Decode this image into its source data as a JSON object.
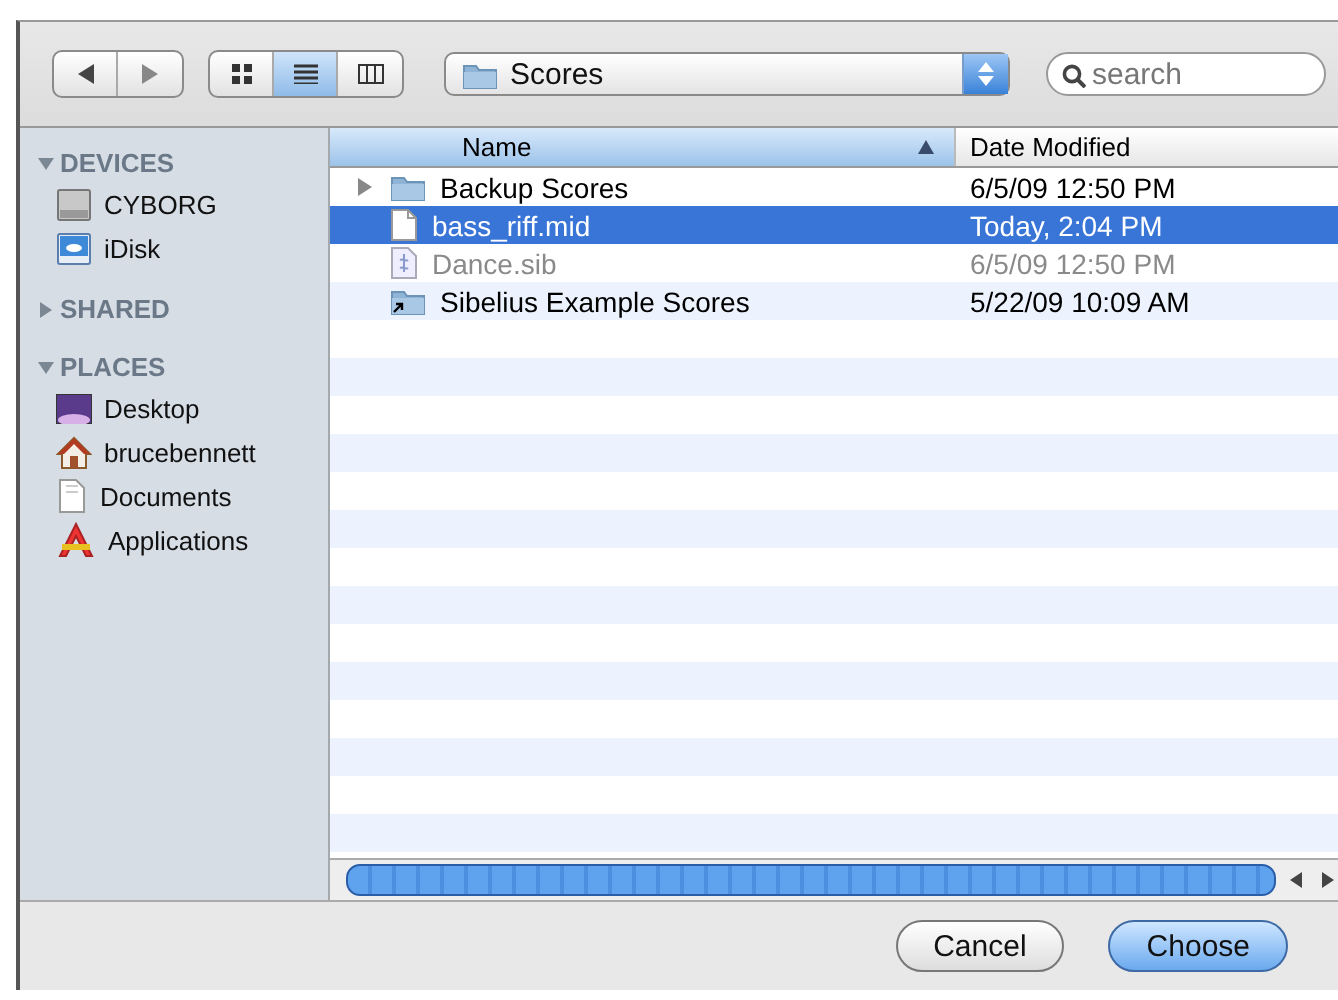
{
  "toolbar": {
    "navigation": [
      {
        "kind": "back"
      },
      {
        "kind": "forward"
      }
    ],
    "view_modes": [
      {
        "kind": "icons",
        "selected": false
      },
      {
        "kind": "list",
        "selected": true
      },
      {
        "kind": "columns",
        "selected": false
      }
    ],
    "location": {
      "label": "Scores"
    },
    "search": {
      "placeholder": "search"
    }
  },
  "sidebar": {
    "sections": [
      {
        "title": "DEVICES",
        "expanded": true,
        "items": [
          {
            "label": "CYBORG",
            "kind": "drive"
          },
          {
            "label": "iDisk",
            "kind": "idisk"
          }
        ]
      },
      {
        "title": "SHARED",
        "expanded": false
      },
      {
        "title": "PLACES",
        "expanded": true,
        "items": [
          {
            "label": "Desktop",
            "kind": "desktop"
          },
          {
            "label": "brucebennett",
            "kind": "home"
          },
          {
            "label": "Documents",
            "kind": "documents"
          },
          {
            "label": "Applications",
            "kind": "applications"
          }
        ]
      }
    ]
  },
  "file_list": {
    "columns": [
      {
        "label": "Name",
        "sorted": true
      },
      {
        "label": "Date Modified",
        "sorted": false
      }
    ],
    "rows": [
      {
        "name": "Backup Scores",
        "date": "6/5/09 12:50 PM",
        "kind": "folder",
        "expandable": true,
        "selected": false,
        "disabled": false
      },
      {
        "name": "bass_riff.mid",
        "date": "Today, 2:04 PM",
        "kind": "file",
        "expandable": false,
        "selected": true,
        "disabled": false
      },
      {
        "name": "Dance.sib",
        "date": "6/5/09 12:50 PM",
        "kind": "score",
        "expandable": false,
        "selected": false,
        "disabled": true
      },
      {
        "name": "Sibelius Example Scores",
        "date": "5/22/09 10:09 AM",
        "kind": "alias",
        "expandable": false,
        "selected": false,
        "disabled": false
      }
    ]
  },
  "buttons": [
    {
      "label": "Cancel",
      "default": false
    },
    {
      "label": "Choose",
      "default": true
    }
  ]
}
